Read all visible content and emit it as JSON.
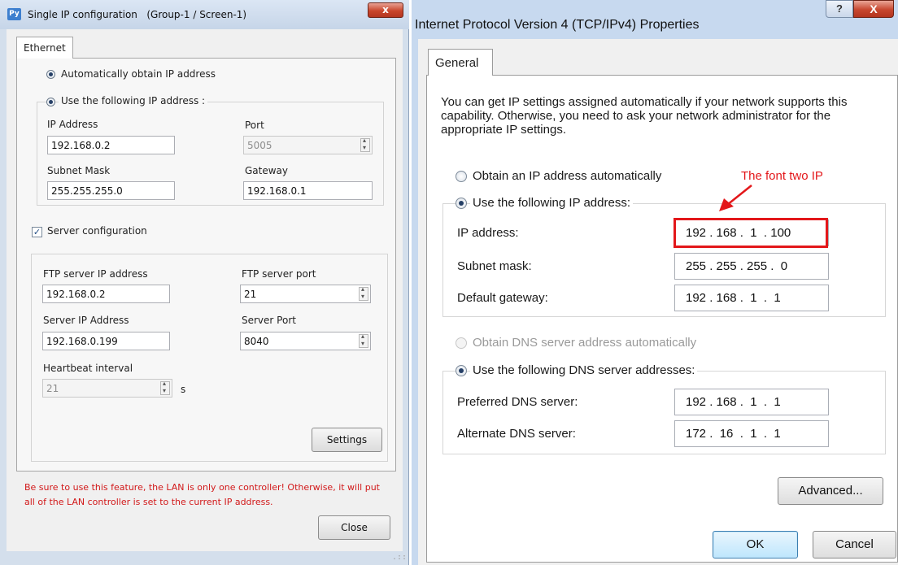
{
  "left": {
    "app_icon": "Py",
    "title": "Single IP configuration   (Group-1 / Screen-1)",
    "close_glyph": "x",
    "tab": "Ethernet",
    "auto_ip_label": "Automatically obtain IP address",
    "use_ip_label": "Use the following IP address :",
    "ip_address_label": "IP Address",
    "ip_address": "192.168.0.2",
    "port_label": "Port",
    "port": "5005",
    "subnet_label": "Subnet Mask",
    "subnet": "255.255.255.0",
    "gateway_label": "Gateway",
    "gateway": "192.168.0.1",
    "server_config_label": "Server configuration",
    "server_config_checked": true,
    "ftp_ip_label": "FTP server IP address",
    "ftp_ip": "192.168.0.2",
    "ftp_port_label": "FTP server port",
    "ftp_port": "21",
    "server_ip_label": "Server IP Address",
    "server_ip": "192.168.0.199",
    "server_port_label": "Server Port",
    "server_port": "8040",
    "heartbeat_label": "Heartbeat interval",
    "heartbeat": "21",
    "heartbeat_unit": "s",
    "settings_button": "Settings",
    "warning": "Be sure to use this feature, the LAN is only one controller! Otherwise, it will put all of the LAN controller is set to the current IP address.",
    "close_button": "Close",
    "grip": ".::"
  },
  "right": {
    "title": "Internet Protocol Version 4 (TCP/IPv4) Properties",
    "help_glyph": "?",
    "close_glyph": "X",
    "tab": "General",
    "description": "You can get IP settings assigned automatically if your network supports this capability. Otherwise, you need to ask your network administrator for the appropriate IP settings.",
    "obtain_auto_label": "Obtain an IP address automatically",
    "use_following_label": "Use the following IP address:",
    "ip_label": "IP address:",
    "ip_value": "192 . 168 .  1  . 100",
    "subnet_label": "Subnet mask:",
    "subnet_value": "255 . 255 . 255 .  0",
    "gateway_label": "Default gateway:",
    "gateway_value": "192 . 168 .  1  .  1",
    "dns_auto_label": "Obtain DNS server address automatically",
    "dns_use_label": "Use the following DNS server addresses:",
    "preferred_dns_label": "Preferred DNS server:",
    "preferred_dns_value": "192 . 168 .  1  .  1",
    "alternate_dns_label": "Alternate DNS server:",
    "alternate_dns_value": "172 .  16  .  1  .  1",
    "advanced_button": "Advanced...",
    "ok_button": "OK",
    "cancel_button": "Cancel"
  },
  "annotation": {
    "text": "The font two IP",
    "color": "#e3171a"
  },
  "colors": {
    "warning_text": "#d2191a",
    "close_red": "#c9462c",
    "titlebar_blue": "#c7d9ef"
  }
}
